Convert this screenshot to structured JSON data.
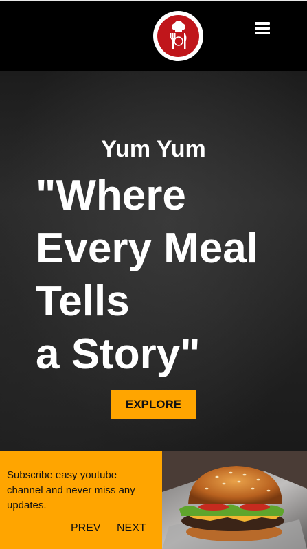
{
  "header": {
    "logo_icon": "restaurant-logo-icon",
    "menu_icon": "hamburger-menu-icon"
  },
  "hero": {
    "brand": "Yum Yum",
    "headline_lines": [
      "\"Where",
      "Every Meal",
      "Tells",
      "a Story\""
    ],
    "cta_label": "EXPLORE"
  },
  "promo": {
    "text": "Subscribe easy youtube channel and never miss any updates.",
    "prev_label": "PREV",
    "next_label": "NEXT",
    "image_icon": "burger-photo"
  },
  "colors": {
    "accent": "#ffa500",
    "logo_red": "#c0161b",
    "background": "#000000"
  }
}
